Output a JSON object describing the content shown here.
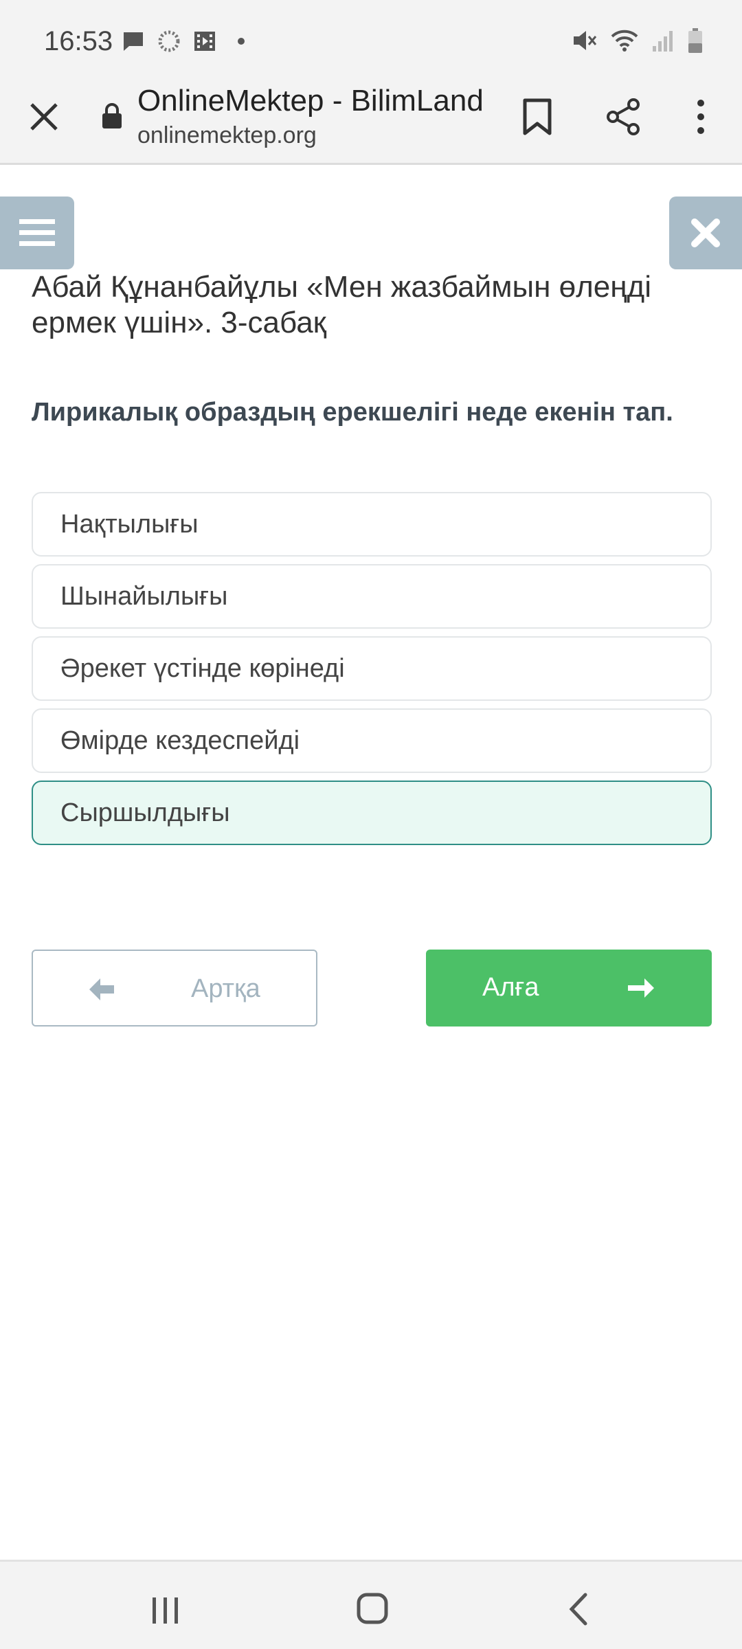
{
  "status_bar": {
    "time": "16:53"
  },
  "browser": {
    "page_title": "OnlineMektep - BilimLand",
    "url": "onlinemektep.org"
  },
  "lesson": {
    "title": "Абай Құнанбайұлы «Мен жазбаймын өлеңді ермек үшін». 3-сабақ",
    "question": "Лирикалық образдың ерекшелігі неде екенін тап.",
    "options": [
      {
        "label": "Нақтылығы",
        "selected": false
      },
      {
        "label": "Шынайылығы",
        "selected": false
      },
      {
        "label": "Әрекет үстінде көрінеді",
        "selected": false
      },
      {
        "label": "Өмірде кездеспейді",
        "selected": false
      },
      {
        "label": "Сыршылдығы",
        "selected": true
      }
    ]
  },
  "navigation": {
    "back_label": "Артқа",
    "next_label": "Алға"
  },
  "colors": {
    "primary_green": "#4cc067",
    "selected_bg": "#e9f9f3",
    "selected_border": "#2f8f86",
    "side_button": "#a9bcc8"
  },
  "icons": [
    "message-icon",
    "sync-icon",
    "video-icon",
    "mute-icon",
    "wifi-icon",
    "signal-icon",
    "battery-icon",
    "close-icon",
    "lock-icon",
    "bookmark-icon",
    "share-icon",
    "more-icon",
    "hamburger-icon",
    "arrow-left-icon",
    "arrow-right-icon",
    "recent-apps-icon",
    "home-icon",
    "back-icon"
  ]
}
